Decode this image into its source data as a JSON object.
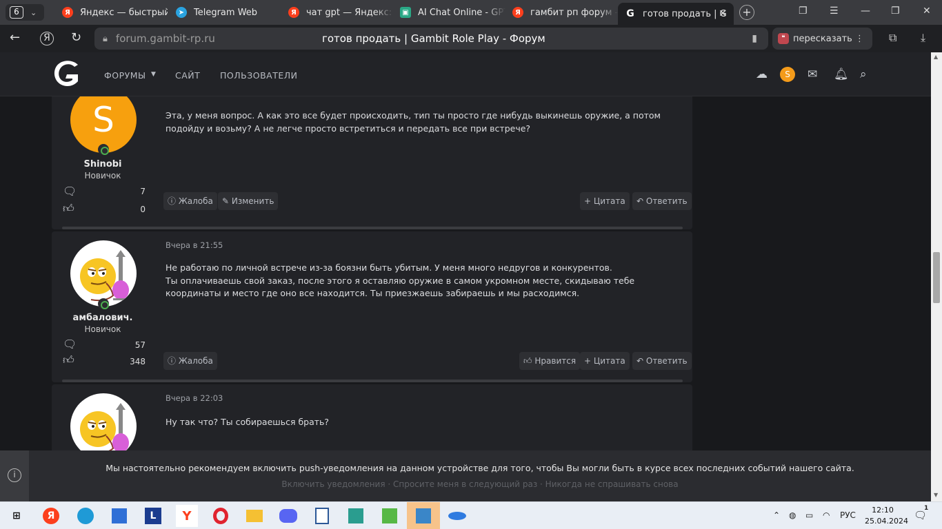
{
  "browser": {
    "tab_count": "6",
    "tabs": [
      {
        "label": "Яндекс — быстрый",
        "icon": "yandex-icon",
        "color": "#fc3f1d"
      },
      {
        "label": "Telegram Web",
        "icon": "telegram-icon",
        "color": "#2aa3e0"
      },
      {
        "label": "чат gpt — Яндекс: н",
        "icon": "yandex-icon",
        "color": "#fc3f1d"
      },
      {
        "label": "AI Chat Online - GPT",
        "icon": "bot-icon",
        "color": "#2aa886"
      },
      {
        "label": "гамбит рп форум —",
        "icon": "yandex-icon",
        "color": "#fc3f1d"
      },
      {
        "label": "готов продать | G",
        "icon": "gambit-icon",
        "color": "#ffffff"
      }
    ],
    "url": "forum.gambit-rp.ru",
    "page_title": "готов продать | Gambit Role Play - Форум",
    "retell_label": "пересказать"
  },
  "site": {
    "nav": [
      "ФОРУМЫ",
      "САЙТ",
      "ПОЛЬЗОВАТЕЛИ"
    ],
    "user_initial": "S",
    "accent": "#f49b1a"
  },
  "posts": [
    {
      "author": "Shinobi",
      "role": "Новичок",
      "avatar_letter": "S",
      "messages": "7",
      "reactions": "0",
      "date": "",
      "text": "Эта, у меня вопрос. А как это все будет происходить, тип ты просто где нибудь выкинешь оружие, а потом подойду и возьму? А не легче просто встретиться и передать все при встрече?",
      "buttons": {
        "report": "Жалоба",
        "edit": "Изменить",
        "quote": "Цитата",
        "reply": "Ответить"
      }
    },
    {
      "author": "амбалович.",
      "role": "Новичок",
      "messages": "57",
      "reactions": "348",
      "date": "Вчера в 21:55",
      "text": "Не работаю по личной встрече из-за боязни быть убитым. У меня много недругов и конкурентов.\nТы оплачиваешь свой заказ, после этого я оставляю оружие в самом укромном месте, скидываю тебе координаты и место где оно все находится. Ты приезжаешь забираешь и мы расходимся.",
      "buttons": {
        "report": "Жалоба",
        "like": "Нравится",
        "quote": "Цитата",
        "reply": "Ответить"
      }
    },
    {
      "date": "Вчера в 22:03",
      "text": "Ну так что? Ты собираешься брать?"
    }
  ],
  "push": {
    "message": "Мы настоятельно рекомендуем включить push-уведомления на данном устройстве для того, чтобы Вы могли быть в курсе всех последних событий нашего сайта.",
    "enable": "Включить уведомления",
    "later": "Спросите меня в следующий раз",
    "never": "Никогда не спрашивать снова"
  },
  "taskbar": {
    "lang": "РУС",
    "time": "12:10",
    "date": "25.04.2024",
    "notif_count": "1"
  }
}
